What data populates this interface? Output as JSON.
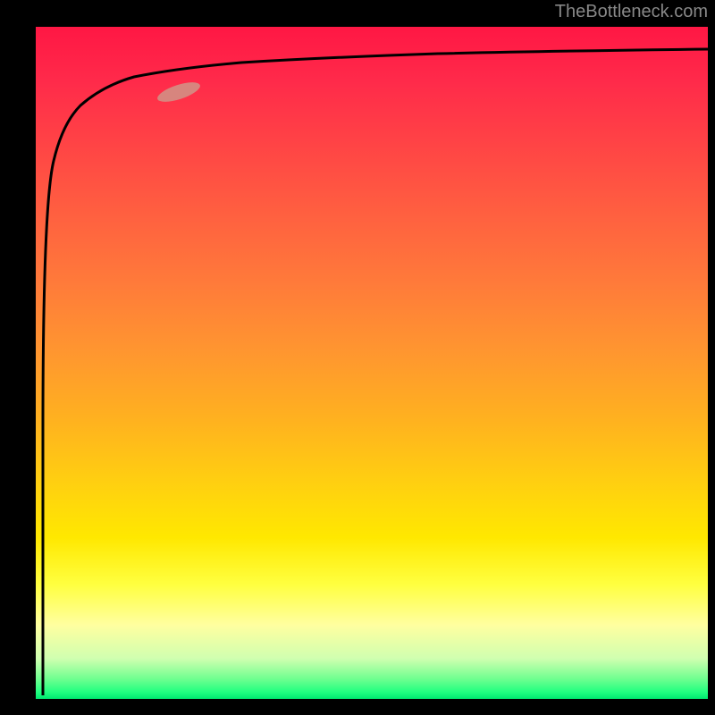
{
  "watermark": "TheBottleneck.com",
  "chart_data": {
    "type": "line",
    "title": "",
    "xlabel": "",
    "ylabel": "",
    "xlim": [
      0,
      100
    ],
    "ylim": [
      0,
      100
    ],
    "series": [
      {
        "name": "curve",
        "x": [
          1,
          1.5,
          2,
          3,
          4,
          6,
          8,
          12,
          18,
          25,
          35,
          50,
          70,
          100
        ],
        "y": [
          0,
          40,
          60,
          77,
          83,
          87,
          89,
          90.5,
          92,
          93,
          94,
          95,
          95.5,
          96
        ]
      }
    ],
    "marker": {
      "x": 18,
      "y": 90,
      "color": "#d58a82"
    },
    "gradient_colors": {
      "top": "#ff1744",
      "middle": "#ffd010",
      "bottom": "#00e870"
    }
  }
}
